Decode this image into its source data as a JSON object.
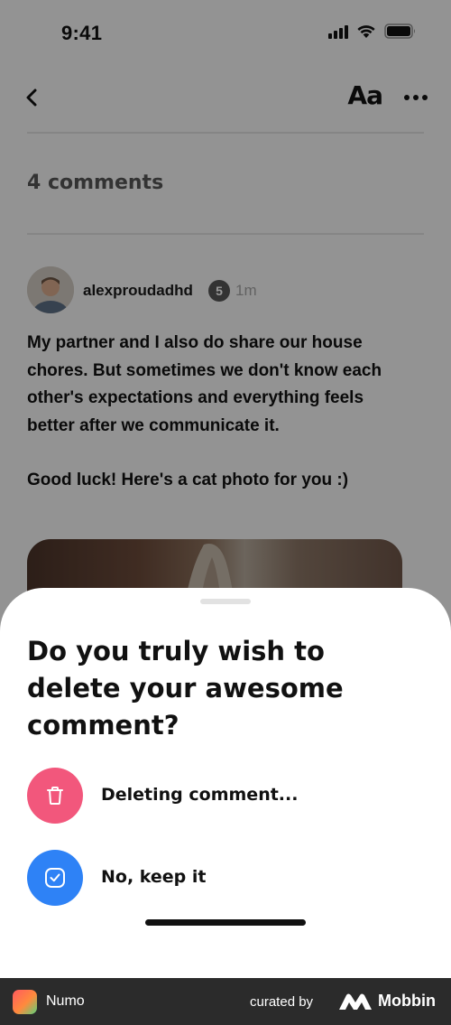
{
  "status_bar": {
    "time": "9:41"
  },
  "header": {
    "font_size_label": "Aa"
  },
  "comments": {
    "count_label": "4 comments",
    "items": [
      {
        "author": "alexproudadhd",
        "level": "5",
        "time": "1m",
        "paragraphs": [
          "My partner and I also do share our house chores. But sometimes we don't know each other's expectations and everything feels better after we communicate it.",
          "Good luck! Here's a cat photo for you :)"
        ]
      }
    ]
  },
  "sheet": {
    "title": "Do you truly wish to delete your awesome comment?",
    "delete_option": {
      "label": "Deleting comment...",
      "icon": "trash-icon",
      "color": "#f2577c"
    },
    "keep_option": {
      "label": "No, keep it",
      "icon": "checkbox-icon",
      "color": "#2e82f6"
    }
  },
  "footer": {
    "app_name": "Numo",
    "curated_by": "curated by",
    "brand": "Mobbin"
  }
}
